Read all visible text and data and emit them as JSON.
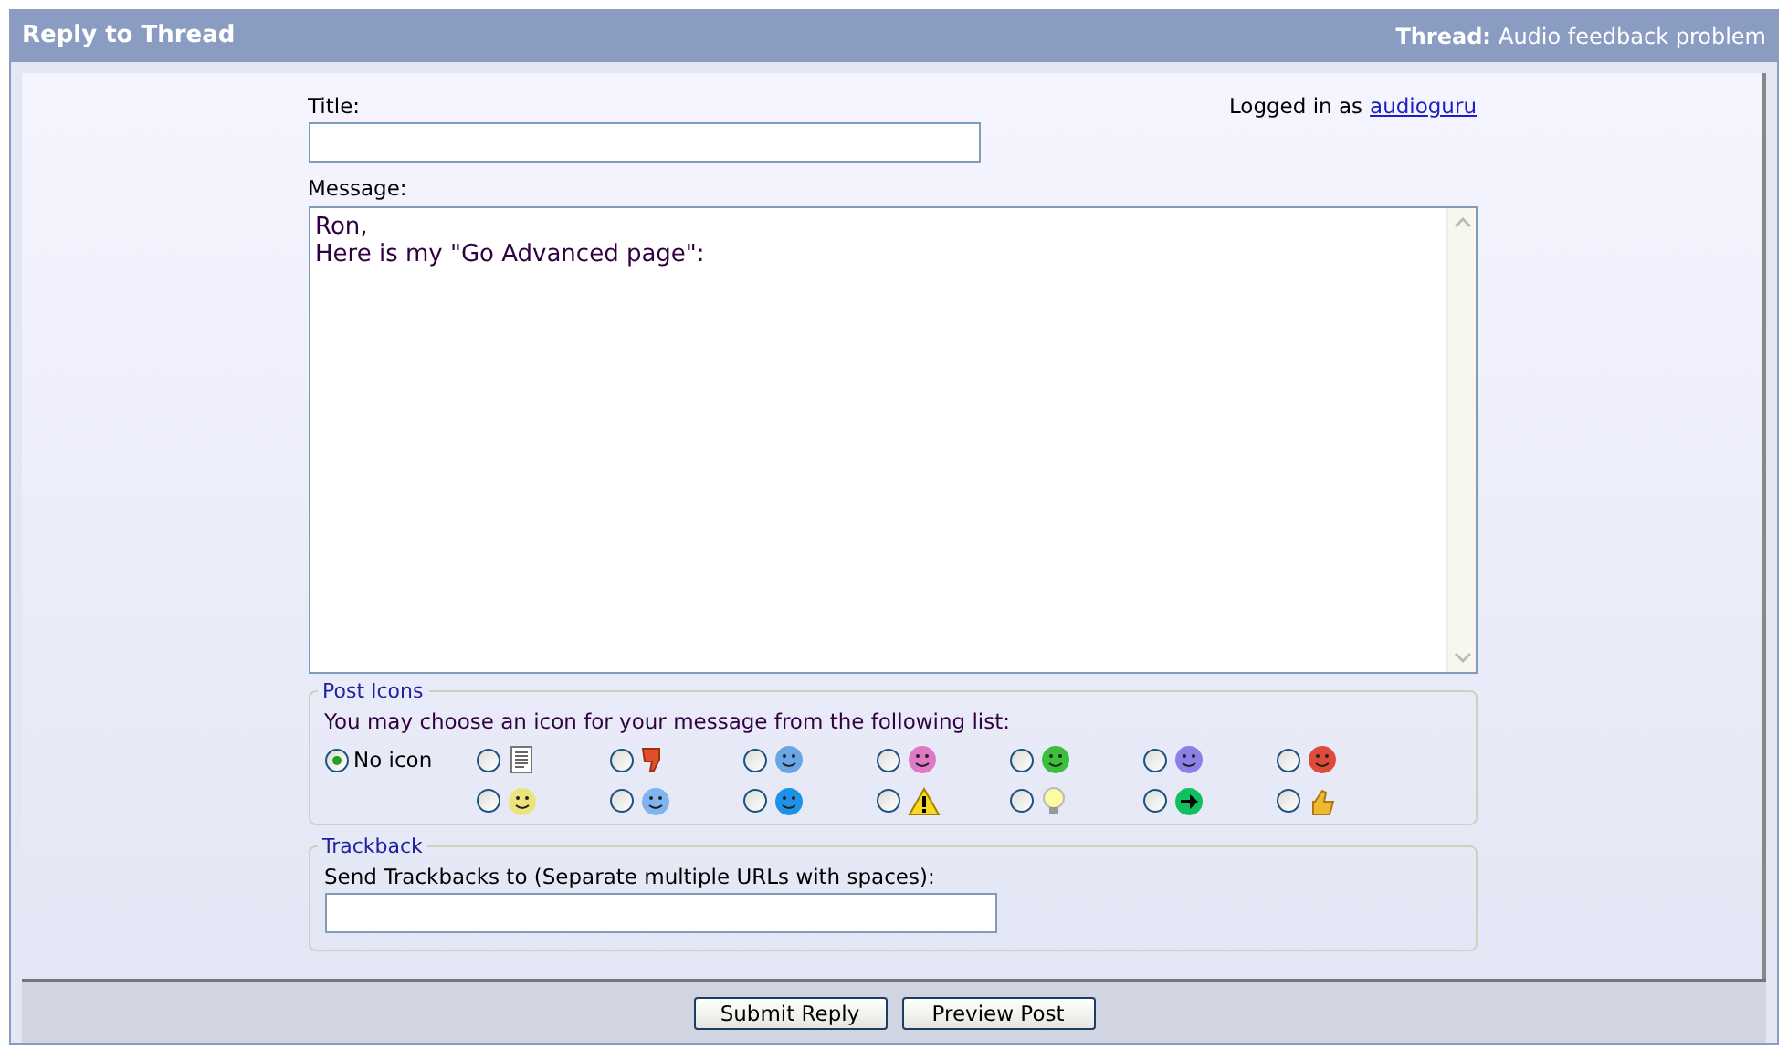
{
  "header": {
    "title": "Reply to Thread",
    "thread_label": "Thread:",
    "thread_title": "Audio feedback problem"
  },
  "title_field": {
    "label": "Title:"
  },
  "login": {
    "text": "Logged in as",
    "user": "audioguru"
  },
  "message": {
    "label": "Message:",
    "value": "Ron,\nHere is my \"Go Advanced page\":"
  },
  "post_icons": {
    "legend": "Post Icons",
    "instruction": "You may choose an icon for your message from the following list:",
    "items": [
      {
        "kind": "none",
        "label": "No icon",
        "selected": true
      },
      {
        "kind": "document",
        "selected": false
      },
      {
        "kind": "thumb-down",
        "selected": false
      },
      {
        "kind": "face",
        "color": "#6aa6e6",
        "selected": false
      },
      {
        "kind": "face",
        "color": "#e078c8",
        "selected": false
      },
      {
        "kind": "face",
        "color": "#3cc03c",
        "selected": false
      },
      {
        "kind": "face",
        "color": "#8a80e6",
        "selected": false
      },
      {
        "kind": "face",
        "color": "#e04a3a",
        "selected": false
      },
      {
        "kind": "face",
        "color": "#ece47a",
        "selected": false
      },
      {
        "kind": "face",
        "color": "#80b4f0",
        "selected": false
      },
      {
        "kind": "face",
        "color": "#1e92e8",
        "selected": false
      },
      {
        "kind": "warning",
        "selected": false
      },
      {
        "kind": "bulb",
        "selected": false
      },
      {
        "kind": "arrow",
        "selected": false
      },
      {
        "kind": "thumb-up",
        "selected": false
      }
    ]
  },
  "trackback": {
    "legend": "Trackback",
    "label": "Send Trackbacks to (Separate multiple URLs with spaces):"
  },
  "buttons": [
    "Submit Reply",
    "Preview Post"
  ]
}
